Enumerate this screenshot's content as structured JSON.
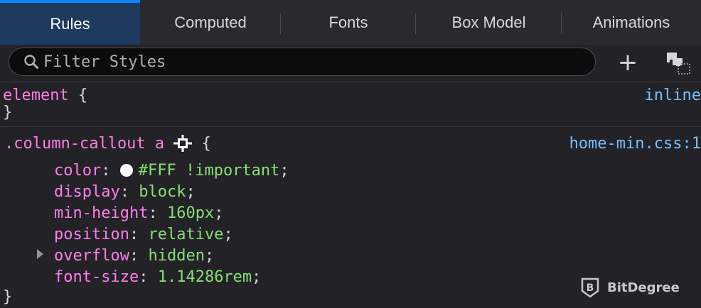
{
  "tabs": [
    {
      "label": "Rules",
      "active": true
    },
    {
      "label": "Computed",
      "active": false
    },
    {
      "label": "Fonts",
      "active": false
    },
    {
      "label": "Box Model",
      "active": false
    },
    {
      "label": "Animations",
      "active": false
    }
  ],
  "filter": {
    "placeholder": "Filter Styles",
    "value": ""
  },
  "toolbar": {
    "add_icon": "plus-icon",
    "classes_icon": "class-panel-icon"
  },
  "rules": {
    "element": {
      "selector": "element",
      "open_brace": "{",
      "close_brace": "}",
      "source": "inline"
    },
    "callout": {
      "selector": ".column-callout a",
      "open_brace": "{",
      "close_brace": "}",
      "source": "home-min.css:1",
      "declarations": [
        {
          "name": "color",
          "value": "#FFF !important",
          "swatch": "#FFFFFF"
        },
        {
          "name": "display",
          "value": "block"
        },
        {
          "name": "min-height",
          "value": "160px"
        },
        {
          "name": "position",
          "value": "relative"
        },
        {
          "name": "overflow",
          "value": "hidden",
          "expandable": true
        },
        {
          "name": "font-size",
          "value": "1.14286rem"
        }
      ]
    }
  },
  "watermark": {
    "text": "BitDegree",
    "icon": "bitdegree-logo-icon"
  },
  "colors": {
    "background": "#232327",
    "tab_active": "#1e3a5f",
    "tab_accent": "#0a84ff",
    "selector": "#ff7de9",
    "value": "#86de74",
    "link": "#75bfff"
  }
}
